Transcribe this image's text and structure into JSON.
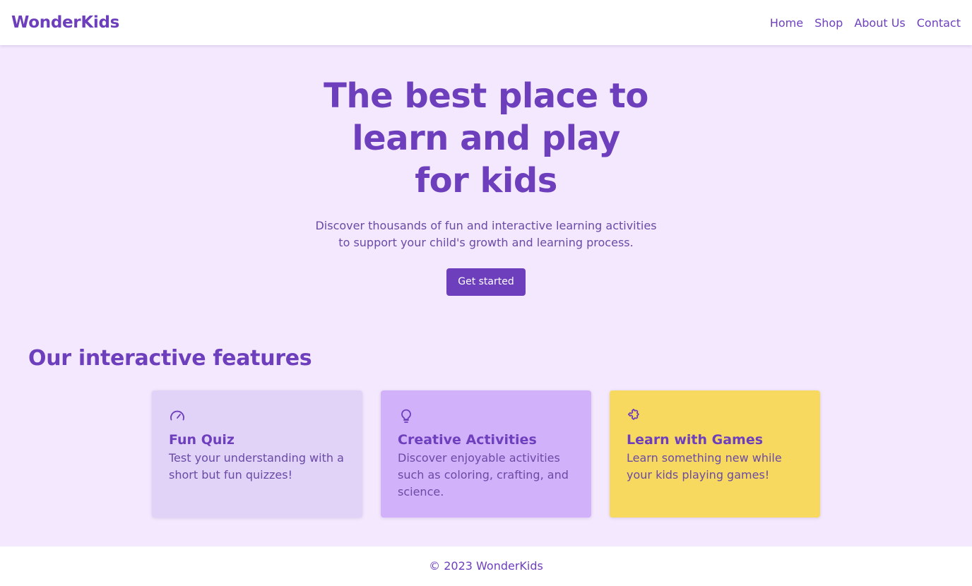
{
  "brand": "WonderKids",
  "nav": [
    "Home",
    "Shop",
    "About Us",
    "Contact"
  ],
  "hero": {
    "title_lines": [
      "The best place to",
      "learn and play",
      "for kids"
    ],
    "subtitle_lines": [
      "Discover thousands of fun and interactive learning activities",
      "to support your child's growth and learning process."
    ],
    "cta": "Get started"
  },
  "features": {
    "title": "Our interactive features",
    "cards": [
      {
        "icon": "gauge-icon",
        "title": "Fun Quiz",
        "text": "Test your understanding with a short but fun quizzes!",
        "bg": "#e1d3f7"
      },
      {
        "icon": "lightbulb-icon",
        "title": "Creative Activities",
        "text": "Discover enjoyable activities such as coloring, crafting, and science.",
        "bg": "#d2b1fb"
      },
      {
        "icon": "puzzle-icon",
        "title": "Learn with Games",
        "text": "Learn something new while your kids playing games!",
        "bg": "#f8d95f"
      }
    ]
  },
  "footer": "© 2023 WonderKids",
  "colors": {
    "accent": "#6e3fbd",
    "page_bg": "#f3e8fd"
  }
}
